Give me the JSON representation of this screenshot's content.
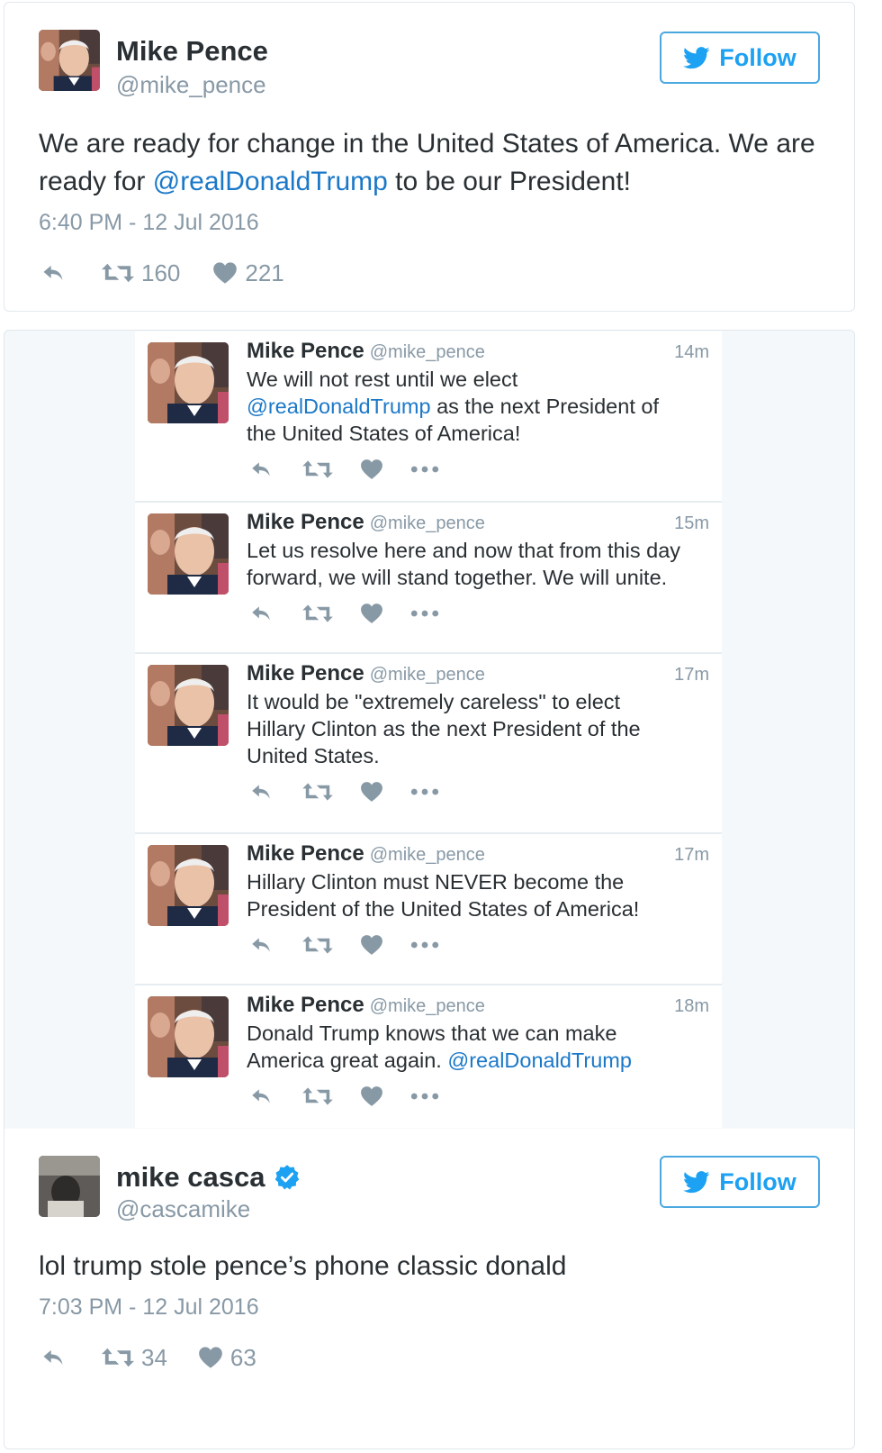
{
  "colors": {
    "accent": "#1da1f2",
    "mention": "#1b78c8",
    "muted": "#8899a6",
    "text": "#292f33",
    "verified": "#1da1f2"
  },
  "top_tweet": {
    "name": "Mike Pence",
    "handle": "@mike_pence",
    "follow_label": "Follow",
    "text_before": "We are ready for change in the United States of America. We are ready for ",
    "mention": "@realDonaldTrump",
    "text_after": " to be our President!",
    "timestamp": "6:40 PM - 12 Jul 2016",
    "retweets": "160",
    "likes": "221"
  },
  "thread": [
    {
      "name": "Mike Pence",
      "handle": "@mike_pence",
      "time": "14m",
      "line1": "We will not rest until we elect",
      "mention": "@realDonaldTrump",
      "line2_after": " as the next President of",
      "line3": "the United States of America!"
    },
    {
      "name": "Mike Pence",
      "handle": "@mike_pence",
      "time": "15m",
      "line1": "Let us resolve here and now that from this day",
      "line2": "forward, we will stand together. We will unite."
    },
    {
      "name": "Mike Pence",
      "handle": "@mike_pence",
      "time": "17m",
      "line1": "It would be \"extremely careless\" to elect",
      "line2": "Hillary Clinton as the next President of the",
      "line3": "United States."
    },
    {
      "name": "Mike Pence",
      "handle": "@mike_pence",
      "time": "17m",
      "line1": "Hillary Clinton must NEVER become the",
      "line2": "President of the United States of America!"
    },
    {
      "name": "Mike Pence",
      "handle": "@mike_pence",
      "time": "18m",
      "line1": "Donald Trump knows that we can make",
      "line2_before": "America great again. ",
      "mention": "@realDonaldTrump"
    }
  ],
  "bottom_tweet": {
    "name": "mike casca",
    "handle": "@cascamike",
    "follow_label": "Follow",
    "text": "lol trump stole pence’s phone classic donald",
    "timestamp": "7:03 PM - 12 Jul 2016",
    "retweets": "34",
    "likes": "63"
  }
}
